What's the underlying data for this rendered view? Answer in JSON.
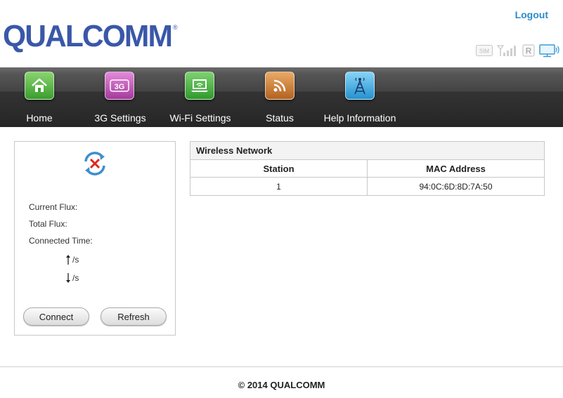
{
  "header": {
    "logo_text": "QUALCOMM",
    "logout_label": "Logout",
    "status_icons": [
      "sim-icon",
      "signal-bars-icon",
      "roaming-icon",
      "display-icon"
    ]
  },
  "nav": {
    "items": [
      {
        "label": "Home",
        "icon": "home-icon",
        "color": "#4cae3c"
      },
      {
        "label": "3G Settings",
        "icon": "3g-icon",
        "color": "#b845b0"
      },
      {
        "label": "Wi-Fi Settings",
        "icon": "laptop-wifi-icon",
        "color": "#3fa63a"
      },
      {
        "label": "Status",
        "icon": "rss-icon",
        "color": "#c8762a"
      },
      {
        "label": "Help Information",
        "icon": "antenna-icon",
        "color": "#2f9ed6"
      }
    ],
    "icon_3g_text": "3G"
  },
  "connection": {
    "status_icon": "disconnected-sync-icon",
    "current_flux_label": "Current Flux:",
    "total_flux_label": "Total Flux:",
    "connected_time_label": "Connected Time:",
    "upload_unit": "/s",
    "download_unit": "/s",
    "connect_label": "Connect",
    "refresh_label": "Refresh"
  },
  "wireless": {
    "title": "Wireless Network",
    "columns": [
      "Station",
      "MAC Address"
    ],
    "rows": [
      {
        "station": "1",
        "mac": "94:0C:6D:8D:7A:50"
      }
    ]
  },
  "footer": {
    "copyright": "© 2014 QUALCOMM"
  }
}
